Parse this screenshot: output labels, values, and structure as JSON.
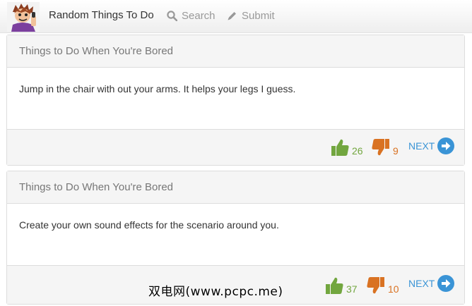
{
  "navbar": {
    "logo_icon": "avatar-logo",
    "brand": "Random Things To Do",
    "search_label": "Search",
    "submit_label": "Submit"
  },
  "posts": [
    {
      "category": "Things to Do When You're Bored",
      "text": "Jump in the chair with out your arms. It helps your legs I guess.",
      "upvotes": "26",
      "downvotes": "9",
      "next_label": "NEXT"
    },
    {
      "category": "Things to Do When You're Bored",
      "text": "Create your own sound effects for the scenario around you.",
      "upvotes": "37",
      "downvotes": "10",
      "next_label": "NEXT"
    }
  ],
  "watermark": "双电网(www.pcpc.me)",
  "colors": {
    "upvote": "#72a63f",
    "downvote": "#d97222",
    "next": "#3a94d6",
    "header_bg": "#f5f5f5"
  }
}
